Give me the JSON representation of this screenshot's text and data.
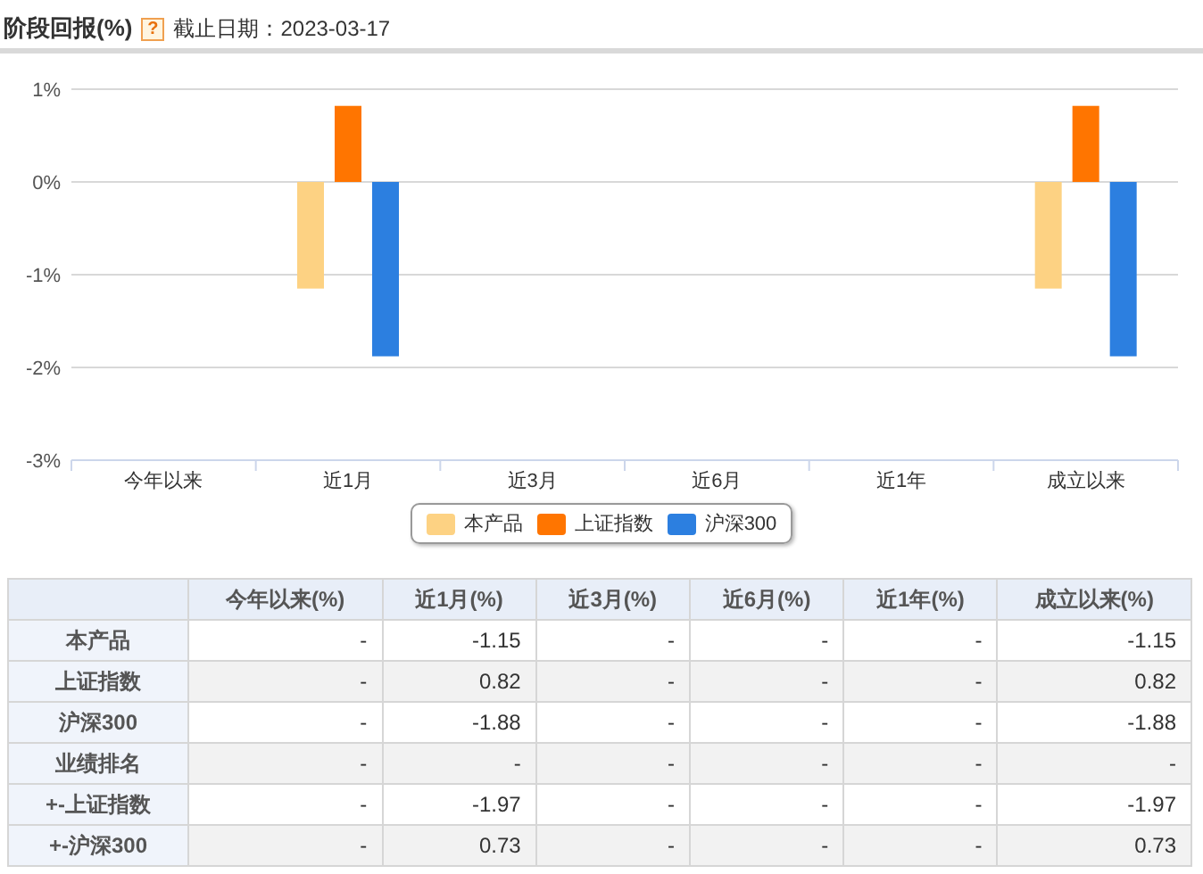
{
  "header": {
    "title": "阶段回报(%)",
    "help_icon": "?",
    "date_label": "截止日期：2023-03-17"
  },
  "chart": {
    "chart_data": {
      "type": "bar",
      "grid": true,
      "categories": [
        "今年以来",
        "近1月",
        "近3月",
        "近6月",
        "近1年",
        "成立以来"
      ],
      "ylim": [
        -3,
        1
      ],
      "yticks": [
        {
          "value": 1,
          "label": "1%"
        },
        {
          "value": 0,
          "label": "0%"
        },
        {
          "value": -1,
          "label": "-1%"
        },
        {
          "value": -2,
          "label": "-2%"
        },
        {
          "value": -3,
          "label": "-3%"
        }
      ],
      "series": [
        {
          "name": "本产品",
          "color": "#fdd283",
          "values": [
            null,
            -1.15,
            null,
            null,
            null,
            -1.15
          ]
        },
        {
          "name": "上证指数",
          "color": "#ff7500",
          "values": [
            null,
            0.82,
            null,
            null,
            null,
            0.82
          ]
        },
        {
          "name": "沪深300",
          "color": "#2c7fe0",
          "values": [
            null,
            -1.88,
            null,
            null,
            null,
            -1.88
          ]
        }
      ]
    }
  },
  "table": {
    "columns": [
      "今年以来(%)",
      "近1月(%)",
      "近3月(%)",
      "近6月(%)",
      "近1年(%)",
      "成立以来(%)"
    ],
    "rows": [
      {
        "label": "本产品",
        "cells": [
          "-",
          "-1.15",
          "-",
          "-",
          "-",
          "-1.15"
        ]
      },
      {
        "label": "上证指数",
        "cells": [
          "-",
          "0.82",
          "-",
          "-",
          "-",
          "0.82"
        ]
      },
      {
        "label": "沪深300",
        "cells": [
          "-",
          "-1.88",
          "-",
          "-",
          "-",
          "-1.88"
        ]
      },
      {
        "label": "业绩排名",
        "cells": [
          "-",
          "-",
          "-",
          "-",
          "-",
          "-"
        ]
      },
      {
        "label": "+-上证指数",
        "cells": [
          "-",
          "-1.97",
          "-",
          "-",
          "-",
          "-1.97"
        ]
      },
      {
        "label": "+-沪深300",
        "cells": [
          "-",
          "0.73",
          "-",
          "-",
          "-",
          "0.73"
        ]
      }
    ]
  }
}
